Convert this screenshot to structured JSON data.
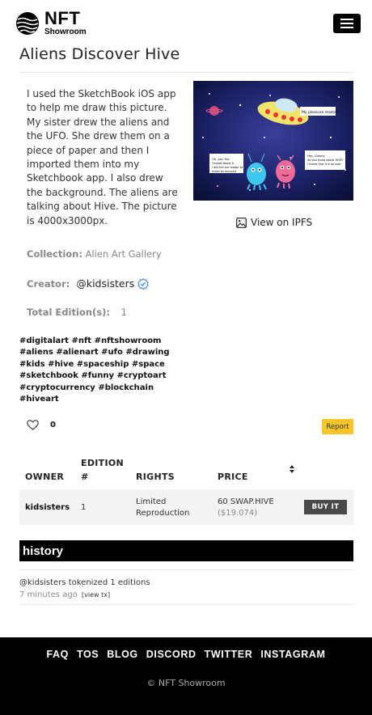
{
  "brand": {
    "name": "NFT",
    "sub": "Showroom"
  },
  "nft": {
    "title": "Aliens Discover Hive",
    "description": "I used the SketchBook iOS app to help me draw this picture. My sister drew the aliens and the UFO. She drew them on a piece of paper and then I imported them into my Sketchbook app. I also drew the background. The aliens are talking about Hive. The picture is 4000x3000px.",
    "view_ipfs": "View on IPFS",
    "artwork": {
      "bubble_ufo": "My pleasure master",
      "bubble_left": "Oh, yes! Yes I heard about it. I will tell our leader to make an account for us",
      "bubble_right": "Hey, Gimmy do you know about HIVE? I heard that it is so cool."
    }
  },
  "meta": {
    "collection_label": "Collection:",
    "collection_value": "Alien Art Gallery",
    "creator_label": "Creator:",
    "creator_value": "@kidsisters",
    "editions_label": "Total Edition(s):",
    "editions_value": "1"
  },
  "tags": [
    "#digitalart",
    "#nft",
    "#nftshowroom",
    "#aliens",
    "#alienart",
    "#ufo",
    "#drawing",
    "#kids",
    "#hive",
    "#spaceship",
    "#space",
    "#sketchbook",
    "#funny",
    "#cryptoart",
    "#cryptocurrency",
    "#blockchain",
    "#hiveart"
  ],
  "likes": {
    "count": "0"
  },
  "report_label": "Report",
  "table": {
    "headers": {
      "owner": "OWNER",
      "edition_1": "EDITION",
      "edition_2": "#",
      "rights": "RIGHTS",
      "price": "PRICE"
    },
    "rows": [
      {
        "owner": "kidsisters",
        "edition": "1",
        "rights_1": "Limited",
        "rights_2": "Reproduction",
        "price": "60 SWAP.HIVE",
        "price_usd": "($19.074)",
        "action": "BUY IT"
      }
    ]
  },
  "history": {
    "title": "history",
    "entries": [
      {
        "text": "@kidsisters tokenized 1 editions",
        "time": "7 minutes ago",
        "link": "[view tx]"
      }
    ]
  },
  "footer": {
    "links": [
      "FAQ",
      "TOS",
      "BLOG",
      "DISCORD",
      "TWITTER",
      "INSTAGRAM"
    ],
    "copyright": "© NFT Showroom"
  },
  "colors": {
    "report": "#f7c429",
    "verified": "#3b82f6",
    "footer_bg": "#000000",
    "art_bg": "#141a4a"
  }
}
